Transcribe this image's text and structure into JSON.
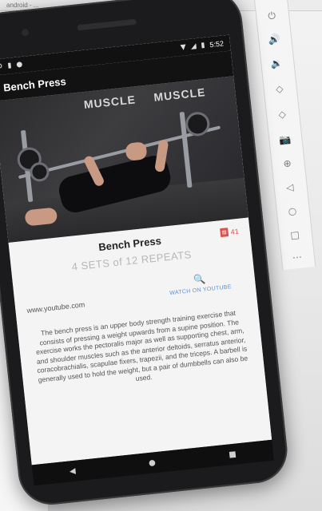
{
  "window": {
    "title": "android - ..."
  },
  "status_bar": {
    "left_icons": [
      "settings-icon",
      "sd-card-icon",
      "circle-icon"
    ],
    "time": "5:52",
    "right_icons": [
      "wifi-icon",
      "signal-icon",
      "battery-icon"
    ]
  },
  "app_bar": {
    "title": "Bench Press"
  },
  "hero": {
    "wall_text_left": "MUSCLE",
    "wall_text_right": "MUSCLE"
  },
  "exercise": {
    "title": "Bench Press",
    "badge_count": "41",
    "sets_text": "4 SETS of 12 REPEATS",
    "source": "www.youtube.com",
    "watch_label": "WATCH ON YOUTUBE",
    "description": "The bench press is an upper body strength training exercise that consists of pressing a weight upwards from a supine position. The exercise works the pectoralis major as well as supporting chest, arm, and shoulder muscles such as the anterior deltoids, serratus anterior, coracobrachialis, scapulae fixers, trapezii, and the triceps. A barbell is generally used to hold the weight, but a pair of dumbbells can also be used."
  },
  "nav": {
    "back": "◀",
    "home": "●",
    "recents": "■"
  },
  "emulator_toolbar": {
    "buttons": [
      "power-icon",
      "volume-up-icon",
      "volume-down-icon",
      "rotate-left-icon",
      "rotate-right-icon",
      "camera-icon",
      "zoom-icon",
      "back-icon",
      "home-icon",
      "overview-icon",
      "more-icon"
    ],
    "glyphs": [
      "⏻",
      "🔊",
      "🔉",
      "◇",
      "◇",
      "📷",
      "⊕",
      "◁",
      "○",
      "□",
      "⋯"
    ]
  },
  "colors": {
    "accent": "#5a8fd8",
    "badge": "#d9534f",
    "app_bar": "#121212"
  }
}
